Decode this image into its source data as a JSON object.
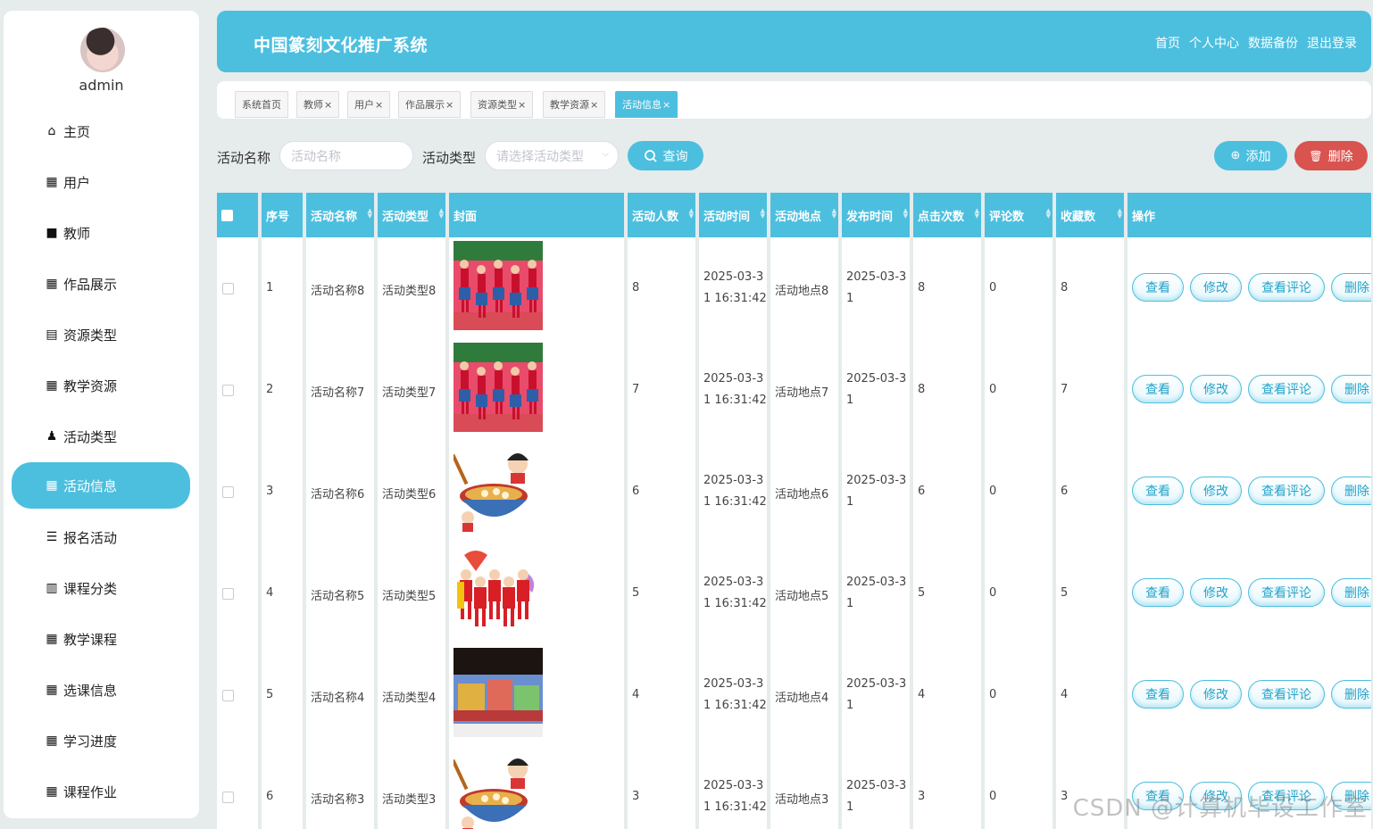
{
  "user": {
    "name": "admin"
  },
  "menu": [
    {
      "label": "主页",
      "icon": "home-icon",
      "glyph": "⌂"
    },
    {
      "label": "用户",
      "icon": "grid-icon",
      "glyph": "▦"
    },
    {
      "label": "教师",
      "icon": "briefcase-icon",
      "glyph": "■"
    },
    {
      "label": "作品展示",
      "icon": "grid-icon",
      "glyph": "▦"
    },
    {
      "label": "资源类型",
      "icon": "clipboard-icon",
      "glyph": "▤"
    },
    {
      "label": "教学资源",
      "icon": "grid-icon",
      "glyph": "▦"
    },
    {
      "label": "活动类型",
      "icon": "person-icon",
      "glyph": "♟"
    },
    {
      "label": "活动信息",
      "icon": "grid-icon",
      "glyph": "▦"
    },
    {
      "label": "报名活动",
      "icon": "list-icon",
      "glyph": "☰"
    },
    {
      "label": "课程分类",
      "icon": "bar-chart-icon",
      "glyph": "▥"
    },
    {
      "label": "教学课程",
      "icon": "apps-icon",
      "glyph": "▦"
    },
    {
      "label": "选课信息",
      "icon": "grid-icon",
      "glyph": "▦"
    },
    {
      "label": "学习进度",
      "icon": "grid-icon",
      "glyph": "▦"
    },
    {
      "label": "课程作业",
      "icon": "grid-icon",
      "glyph": "▦"
    }
  ],
  "header": {
    "title": "中国篆刻文化推广系统",
    "nav": [
      "首页",
      "个人中心",
      "数据备份",
      "退出登录"
    ]
  },
  "tabs": [
    {
      "label": "系统首页",
      "closable": false
    },
    {
      "label": "教师",
      "closable": true
    },
    {
      "label": "用户",
      "closable": true
    },
    {
      "label": "作品展示",
      "closable": true
    },
    {
      "label": "资源类型",
      "closable": true
    },
    {
      "label": "教学资源",
      "closable": true
    },
    {
      "label": "活动信息",
      "closable": true
    }
  ],
  "search": {
    "name_label": "活动名称",
    "name_placeholder": "活动名称",
    "type_label": "活动类型",
    "type_placeholder": "请选择活动类型",
    "query_button": "查询",
    "add_button": "添加",
    "delete_button": "删除"
  },
  "table": {
    "columns": [
      "序号",
      "活动名称",
      "活动类型",
      "封面",
      "活动人数",
      "活动时间",
      "活动地点",
      "发布时间",
      "点击次数",
      "评论数",
      "收藏数",
      "操作"
    ],
    "actions": [
      "查看",
      "修改",
      "查看评论",
      "删除"
    ],
    "rows": [
      {
        "no": "1",
        "name": "活动名称8",
        "type": "活动类型8",
        "cover": "dance",
        "people": "8",
        "time1": "2025-03-3",
        "time2": "1 16:31:42",
        "place": "活动地点8",
        "pub1": "2025-03-3",
        "pub2": "1",
        "clicks": "8",
        "comments": "0",
        "favs": "8"
      },
      {
        "no": "2",
        "name": "活动名称7",
        "type": "活动类型7",
        "cover": "dance",
        "people": "7",
        "time1": "2025-03-3",
        "time2": "1 16:31:42",
        "place": "活动地点7",
        "pub1": "2025-03-3",
        "pub2": "1",
        "clicks": "8",
        "comments": "0",
        "favs": "7"
      },
      {
        "no": "3",
        "name": "活动名称6",
        "type": "活动类型6",
        "cover": "bowl",
        "people": "6",
        "time1": "2025-03-3",
        "time2": "1 16:31:42",
        "place": "活动地点6",
        "pub1": "2025-03-3",
        "pub2": "1",
        "clicks": "6",
        "comments": "0",
        "favs": "6"
      },
      {
        "no": "4",
        "name": "活动名称5",
        "type": "活动类型5",
        "cover": "fan",
        "people": "5",
        "time1": "2025-03-3",
        "time2": "1 16:31:42",
        "place": "活动地点5",
        "pub1": "2025-03-3",
        "pub2": "1",
        "clicks": "5",
        "comments": "0",
        "favs": "5"
      },
      {
        "no": "5",
        "name": "活动名称4",
        "type": "活动类型4",
        "cover": "float",
        "people": "4",
        "time1": "2025-03-3",
        "time2": "1 16:31:42",
        "place": "活动地点4",
        "pub1": "2025-03-3",
        "pub2": "1",
        "clicks": "4",
        "comments": "0",
        "favs": "4"
      },
      {
        "no": "6",
        "name": "活动名称3",
        "type": "活动类型3",
        "cover": "bowl",
        "people": "3",
        "time1": "2025-03-3",
        "time2": "1 16:31:42",
        "place": "活动地点3",
        "pub1": "2025-03-3",
        "pub2": "1",
        "clicks": "3",
        "comments": "0",
        "favs": "3"
      }
    ]
  },
  "watermark": "CSDN @计算机毕设工作室",
  "colors": {
    "accent": "#4cbfdf",
    "danger": "#d9534f",
    "background": "#e6ebec"
  }
}
